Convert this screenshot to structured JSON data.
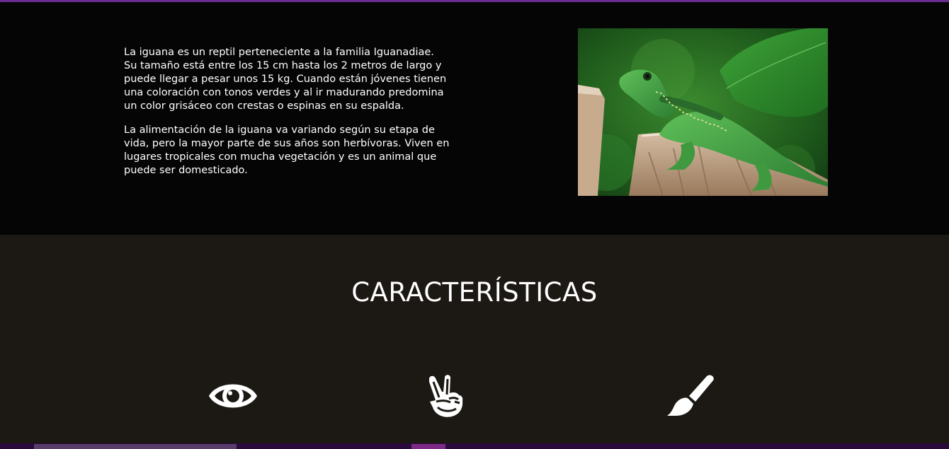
{
  "intro": {
    "paragraph_1": "La iguana es un reptil perteneciente a la familia Iguanadiae. Su tamaño está entre los 15 cm hasta los 2 metros de largo y puede llegar a pesar unos 15 kg. Cuando están jóvenes tienen una coloración con tonos verdes y al ir madurando predomina un color grisáceo con crestas o espinas en su espalda.",
    "paragraph_2": "La alimentación de la iguana va variando según su etapa de vida, pero la mayor parte de sus años son herbívoras. Viven en lugares tropicales con mucha vegetación y es un animal que puede ser domesticado.",
    "image": "iguana-photo"
  },
  "features": {
    "title": "CARACTERÍSTICAS",
    "icons": [
      "eye-icon",
      "victory-hand-icon",
      "paintbrush-icon"
    ]
  },
  "colors": {
    "top_accent": "#6a2d8f",
    "intro_bg": "#050505",
    "features_bg": "#1c1813",
    "taskbar_bg": "#2a0a3c"
  }
}
